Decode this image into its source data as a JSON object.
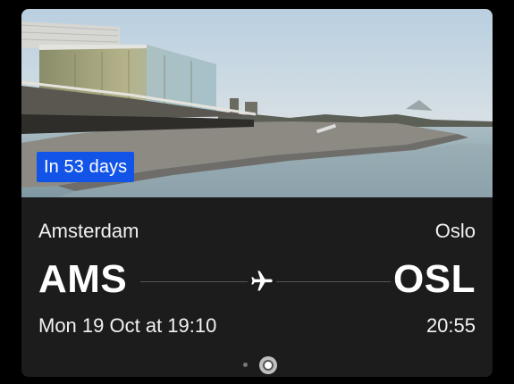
{
  "hero": {
    "image_subject": "opera-house-photo",
    "badge": "In 53 days"
  },
  "flight": {
    "origin": {
      "city": "Amsterdam",
      "code": "AMS",
      "departure": "Mon 19 Oct at 19:10"
    },
    "destination": {
      "city": "Oslo",
      "code": "OSL",
      "arrival": "20:55"
    },
    "icon": "airplane-icon"
  },
  "pager": {
    "total": 2,
    "active_index": 1
  },
  "colors": {
    "badge": "#1354e8",
    "card_bg": "#1c1c1c",
    "page_bg": "#000000"
  }
}
